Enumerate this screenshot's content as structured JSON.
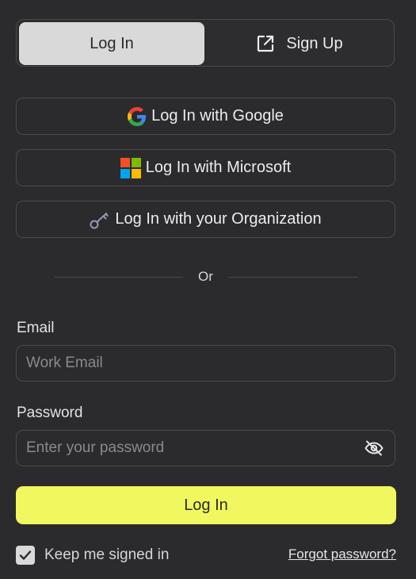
{
  "tabs": {
    "login_label": "Log In",
    "signup_label": "Sign Up",
    "active": "login"
  },
  "sso": {
    "google_label": "Log In with Google",
    "microsoft_label": "Log In with Microsoft",
    "org_label": "Log In with your Organization"
  },
  "divider": {
    "text": "Or"
  },
  "form": {
    "email": {
      "label": "Email",
      "value": "",
      "placeholder": "Work Email"
    },
    "password": {
      "label": "Password",
      "value": "",
      "placeholder": "Enter your password",
      "visibility_icon": "eye-off-icon"
    },
    "submit_label": "Log In",
    "keep_signed_in_label": "Keep me signed in",
    "keep_signed_in_checked": true,
    "forgot_label": "Forgot password?"
  },
  "icons": {
    "signup": "external-link-icon",
    "google": "google-icon",
    "microsoft": "microsoft-icon",
    "org": "key-icon"
  },
  "colors": {
    "background": "#2b2b2d",
    "border": "#4a4a4d",
    "active_tab": "#d9d9d9",
    "primary_button": "#f1f75f",
    "text": "#ececec"
  }
}
